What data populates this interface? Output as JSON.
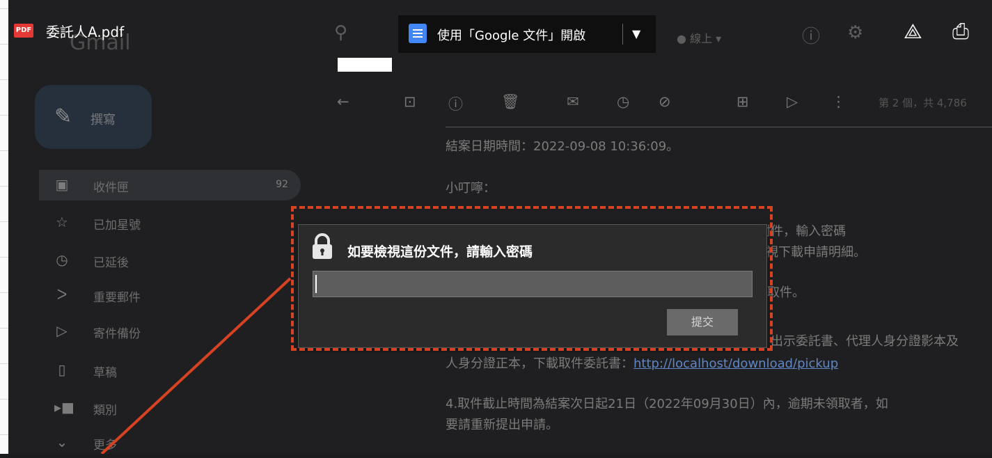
{
  "pdf_viewer": {
    "badge": "PDF",
    "file_name": "委託人A.pdf",
    "open_with_label": "使用「Google 文件」開啟",
    "icons": [
      "add-to-drive-icon",
      "print-icon"
    ]
  },
  "gmail": {
    "logo": "Gmail",
    "compose_label": "撰寫",
    "status_label": "線上",
    "page_count": "第 2 個，共 4,786",
    "nav": [
      {
        "label": "收件匣",
        "count": "92",
        "icon": "inbox-icon"
      },
      {
        "label": "已加星號",
        "icon": "star-icon"
      },
      {
        "label": "已延後",
        "icon": "clock-icon"
      },
      {
        "label": "重要郵件",
        "icon": "important-icon"
      },
      {
        "label": "寄件備份",
        "icon": "send-icon"
      },
      {
        "label": "草稿",
        "icon": "draft-icon"
      },
      {
        "label": "類別",
        "icon": "label-icon"
      },
      {
        "label": "更多",
        "icon": "chevron-down-icon"
      }
    ],
    "email": {
      "line1": "結案日期時間：2022-09-08 10:36:09。",
      "line2": "小叮嚀：",
      "line3": "1.授權選擇…，申請資料已隨此封電子郵件寄送，請打開附件，輸入密碼",
      "line4": "檢視下載申請明細。",
      "line5": "取件。",
      "line6": "出示委託書、代理人身分證影本及",
      "line7_text": "人身分證正本，下載取件委託書：",
      "line7_link": "http://localhost/download/pickup",
      "line8": "4.取件截止時間為結案次日起21日（2022年09月30日）內，逾期未領取者，如",
      "line9": "要請重新提出申請。"
    }
  },
  "dialog": {
    "title": "如要檢視這份文件，請輸入密碼",
    "password_value": "",
    "submit_label": "提交"
  },
  "colors": {
    "annotation": "#d64222",
    "docs_blue": "#4285f4",
    "pdf_red": "#e53935"
  }
}
